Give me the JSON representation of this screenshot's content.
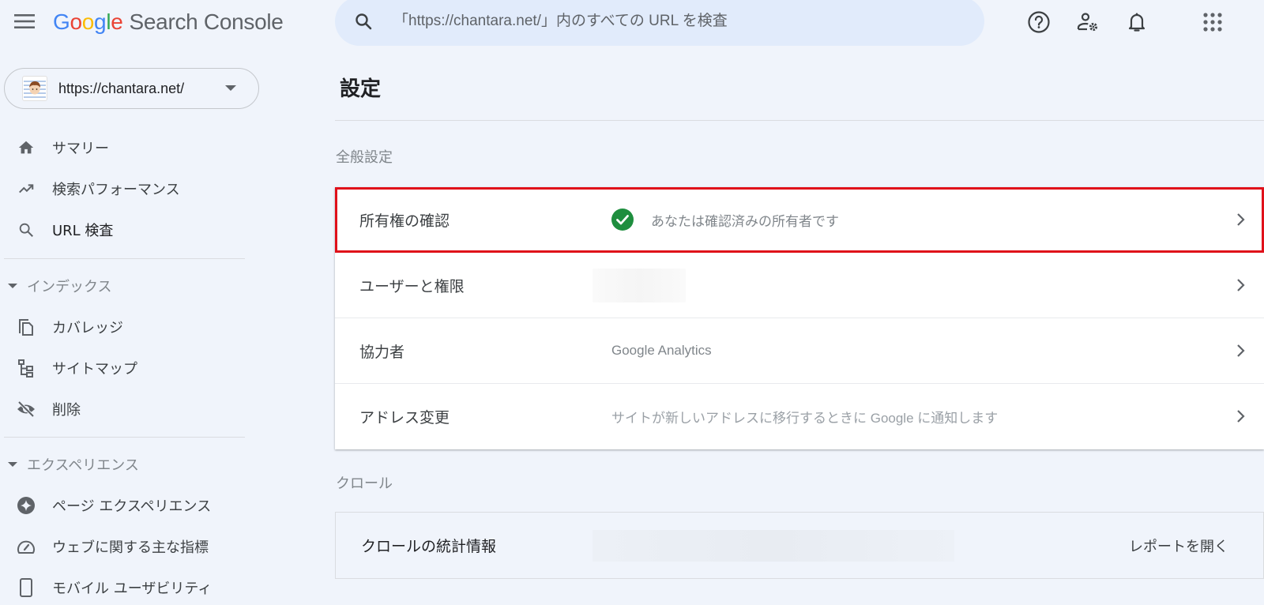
{
  "header": {
    "logo_letters": [
      "G",
      "o",
      "o",
      "g",
      "l",
      "e"
    ],
    "product_name": "Search Console",
    "search_placeholder": "「https://chantara.net/」内のすべての URL を検査",
    "icons": [
      "menu-icon",
      "search-icon",
      "help-icon",
      "manage-users-icon",
      "notifications-icon",
      "apps-icon"
    ]
  },
  "sidebar": {
    "property": {
      "url": "https://chantara.net/"
    },
    "items": [
      {
        "label": "サマリー",
        "icon": "home-icon"
      },
      {
        "label": "検索パフォーマンス",
        "icon": "trending-up-icon"
      },
      {
        "label": "URL 検査",
        "icon": "search-icon"
      }
    ],
    "sections": [
      {
        "title": "インデックス",
        "items": [
          {
            "label": "カバレッジ",
            "icon": "copy-pages-icon"
          },
          {
            "label": "サイトマップ",
            "icon": "sitemap-icon"
          },
          {
            "label": "削除",
            "icon": "visibility-off-icon"
          }
        ]
      },
      {
        "title": "エクスペリエンス",
        "items": [
          {
            "label": "ページ エクスペリエンス",
            "icon": "page-experience-icon"
          },
          {
            "label": "ウェブに関する主な指標",
            "icon": "speed-gauge-icon"
          },
          {
            "label": "モバイル ユーザビリティ",
            "icon": "smartphone-icon"
          }
        ]
      }
    ]
  },
  "main": {
    "page_title": "設定",
    "general_section": {
      "title": "全般設定",
      "rows": [
        {
          "label": "所有権の確認",
          "value": "あなたは確認済みの所有者です",
          "status": "verified",
          "highlighted": true
        },
        {
          "label": "ユーザーと権限",
          "value": "",
          "redacted": true
        },
        {
          "label": "協力者",
          "value": "Google Analytics"
        },
        {
          "label": "アドレス変更",
          "value": "サイトが新しいアドレスに移行するときに Google に通知します"
        }
      ]
    },
    "crawl_section": {
      "title": "クロール",
      "rows": [
        {
          "label": "クロールの統計情報",
          "action": "レポートを開く",
          "redacted": true
        }
      ]
    }
  },
  "colors": {
    "background": "#f0f4fb",
    "search_bg": "#e1ebfb",
    "verified_green": "#1e8e3e",
    "highlight_red": "#e0101a"
  }
}
